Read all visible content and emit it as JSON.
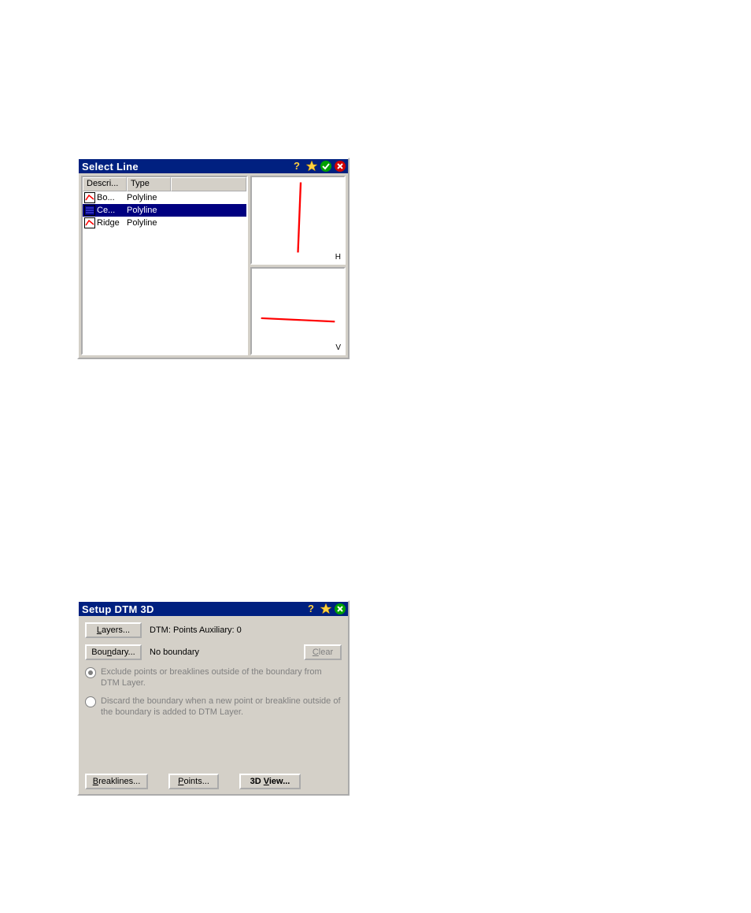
{
  "select_line": {
    "title": "Select Line",
    "columns": {
      "desc": "Descri...",
      "type": "Type"
    },
    "rows": [
      {
        "desc": "Bo...",
        "type": "Polyline",
        "icon": "red",
        "selected": false
      },
      {
        "desc": "Ce...",
        "type": "Polyline",
        "icon": "blue",
        "selected": true
      },
      {
        "desc": "Ridge",
        "type": "Polyline",
        "icon": "red",
        "selected": false
      }
    ],
    "preview_labels": {
      "horiz": "H",
      "vert": "V"
    }
  },
  "setup_dtm": {
    "title": "Setup DTM 3D",
    "layers_btn": "Layers...",
    "layers_status": "DTM: Points Auxiliary: 0",
    "boundary_btn": "Boundary...",
    "boundary_status": "No boundary",
    "clear_btn": "Clear",
    "option_exclude": "Exclude points or breaklines outside of the boundary from DTM Layer.",
    "option_discard": "Discard the boundary when a new point or breakline outside of the boundary is added to DTM Layer.",
    "breaklines_btn": "Breaklines...",
    "points_btn": "Points...",
    "view3d_btn": "3D View..."
  },
  "colors": {
    "accent_stroke": "#ff0000",
    "selection_bg": "#000080",
    "selection_fg": "#ffffff"
  }
}
